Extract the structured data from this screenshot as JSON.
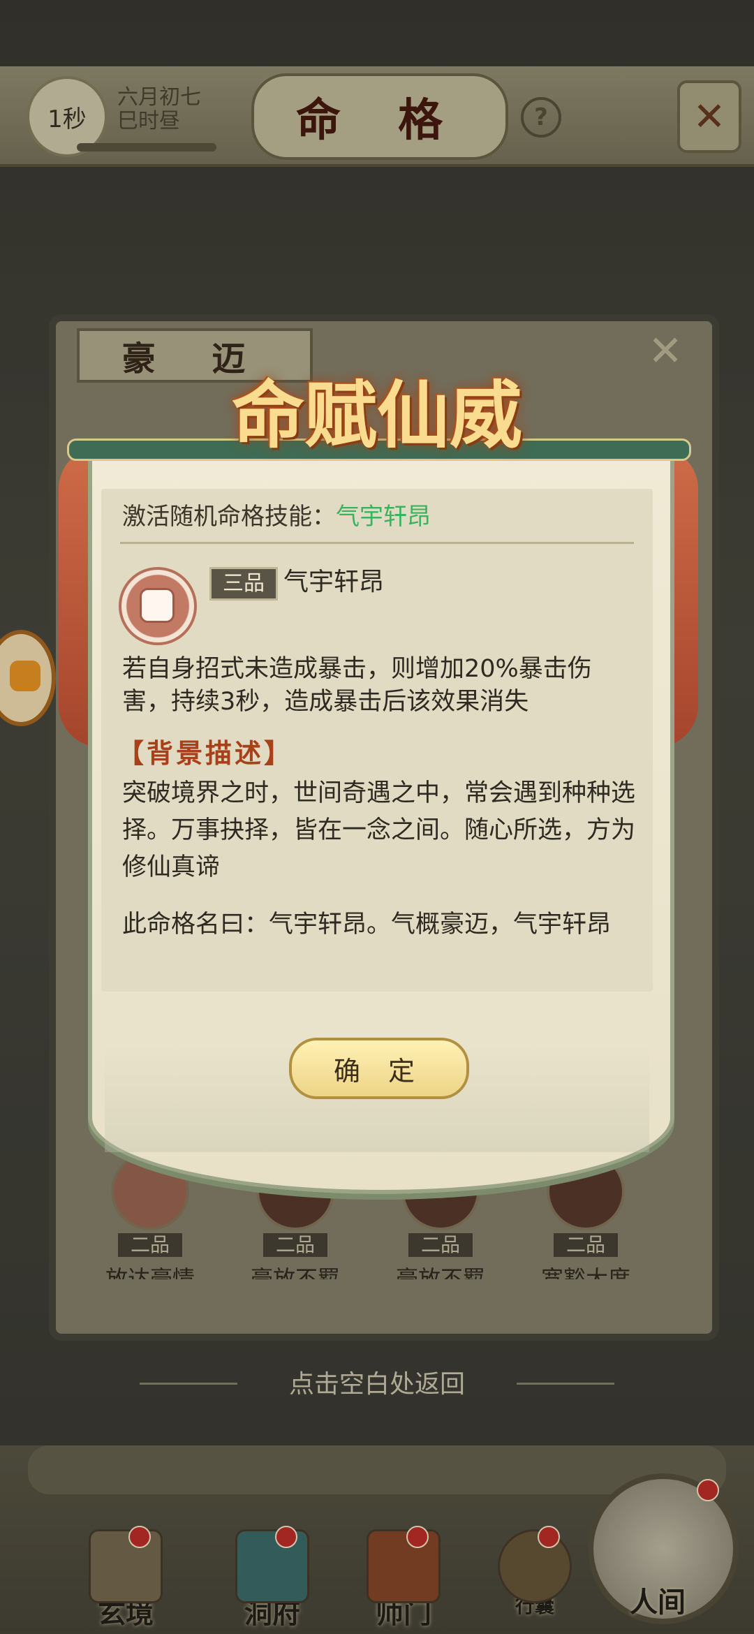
{
  "header": {
    "timer": "1秒",
    "date_line1": "六月初七",
    "date_line2": "巳时昼",
    "title": "命 格",
    "help_symbol": "?",
    "close_symbol": "✕"
  },
  "panel": {
    "title": "豪 迈",
    "close_symbol": "✕",
    "skills": [
      {
        "grade": "二品",
        "name": "放达豪情"
      },
      {
        "grade": "二品",
        "name": "豪放不羁"
      },
      {
        "grade": "二品",
        "name": "豪放不羁"
      },
      {
        "grade": "二品",
        "name": "宽豁大度"
      }
    ]
  },
  "modal": {
    "title": "命赋仙威",
    "activate_label": "激活随机命格技能：",
    "activate_skill": "气宇轩昂",
    "skill_grade": "三品",
    "skill_name": "气宇轩昂",
    "effect": "若自身招式未造成暴击，则增加20%暴击伤害，持续3秒，造成暴击后该效果消失",
    "background_heading": "【背景描述】",
    "background_text": "突破境界之时，世间奇遇之中，常会遇到种种选择。万事抉择，皆在一念之间。随心所选，方为修仙真谛",
    "name_text": "此命格名曰：气宇轩昂。气概豪迈，气宇轩昂",
    "confirm_label": "确 定"
  },
  "return_hint": "点击空白处返回",
  "bottom_nav": [
    {
      "label": "玄境",
      "icon": "scroll-icon"
    },
    {
      "label": "洞府",
      "icon": "pavilion-icon"
    },
    {
      "label": "师门",
      "icon": "banner-icon"
    },
    {
      "label": "行囊",
      "icon": "bag-icon"
    },
    {
      "label": "人间",
      "icon": "world-icon"
    }
  ],
  "colors": {
    "accent_green": "#3cb15e",
    "heading_red": "#a8411a",
    "badge_red": "#c62f2a"
  }
}
